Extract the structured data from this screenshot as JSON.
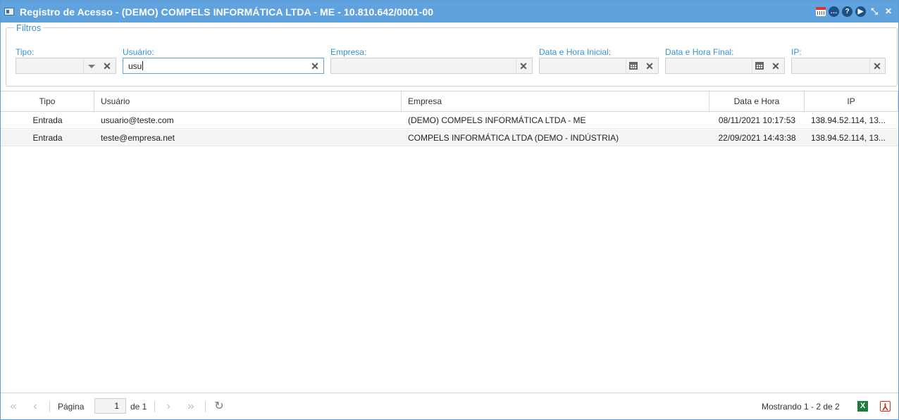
{
  "window": {
    "title": "Registro de Acesso - (DEMO) COMPELS INFORMÁTICA LTDA - ME - 10.810.642/0001-00"
  },
  "toolbar_icons": [
    "calendar-icon",
    "chat-icon",
    "help-icon",
    "play-icon",
    "restore-icon",
    "close-icon"
  ],
  "filters": {
    "legend": "Filtros",
    "tipo": {
      "label": "Tipo:",
      "value": ""
    },
    "usuario": {
      "label": "Usuário:",
      "value": "usu"
    },
    "empresa": {
      "label": "Empresa:",
      "value": ""
    },
    "data_inicial": {
      "label": "Data e Hora Inicial:",
      "value": ""
    },
    "data_final": {
      "label": "Data e Hora Final:",
      "value": ""
    },
    "ip": {
      "label": "IP:",
      "value": ""
    }
  },
  "grid": {
    "columns": [
      "Tipo",
      "Usuário",
      "Empresa",
      "Data e Hora",
      "IP"
    ],
    "rows": [
      {
        "tipo": "Entrada",
        "usuario": "usuario@teste.com",
        "empresa": "(DEMO) COMPELS INFORMÁTICA LTDA - ME",
        "data": "08/11/2021 10:17:53",
        "ip": "138.94.52.114, 13..."
      },
      {
        "tipo": "Entrada",
        "usuario": "teste@empresa.net",
        "empresa": "COMPELS INFORMÁTICA LTDA (DEMO - INDÚSTRIA)",
        "data": "22/09/2021 14:43:38",
        "ip": "138.94.52.114, 13..."
      }
    ]
  },
  "pager": {
    "page_label": "Página",
    "page_value": "1",
    "of_label": "de 1",
    "showing": "Mostrando 1 - 2 de 2"
  },
  "export_icons": [
    "excel-icon",
    "pdf-icon"
  ]
}
